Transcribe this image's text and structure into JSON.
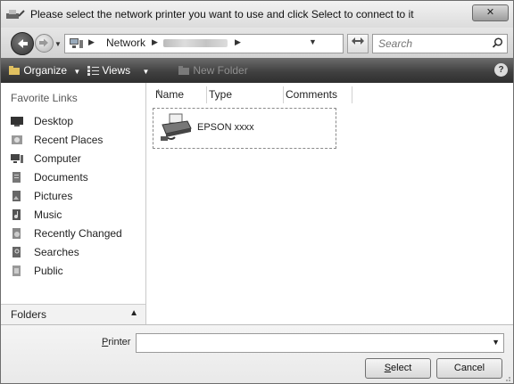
{
  "window": {
    "title": "Please select the network printer you want to use and click Select to connect to it",
    "close_label": "✕"
  },
  "address_bar": {
    "breadcrumb": [
      "Network"
    ],
    "search_placeholder": "Search"
  },
  "toolbar": {
    "organize_label": "Organize",
    "views_label": "Views",
    "new_folder_label": "New Folder",
    "help_label": "?"
  },
  "sidebar": {
    "heading": "Favorite Links",
    "items": [
      {
        "label": "Desktop",
        "icon": "desktop-icon"
      },
      {
        "label": "Recent Places",
        "icon": "recent-places-icon"
      },
      {
        "label": "Computer",
        "icon": "computer-icon"
      },
      {
        "label": "Documents",
        "icon": "documents-icon"
      },
      {
        "label": "Pictures",
        "icon": "pictures-icon"
      },
      {
        "label": "Music",
        "icon": "music-icon"
      },
      {
        "label": "Recently Changed",
        "icon": "recently-changed-icon"
      },
      {
        "label": "Searches",
        "icon": "searches-icon"
      },
      {
        "label": "Public",
        "icon": "public-icon"
      }
    ],
    "folders_label": "Folders"
  },
  "file_list": {
    "columns": [
      "Name",
      "Type",
      "Comments"
    ],
    "items": [
      {
        "label": "EPSON xxxx",
        "icon": "printer-icon"
      }
    ]
  },
  "footer": {
    "printer_label": "Printer",
    "printer_value": "",
    "select_label": "Select",
    "cancel_label": "Cancel"
  }
}
